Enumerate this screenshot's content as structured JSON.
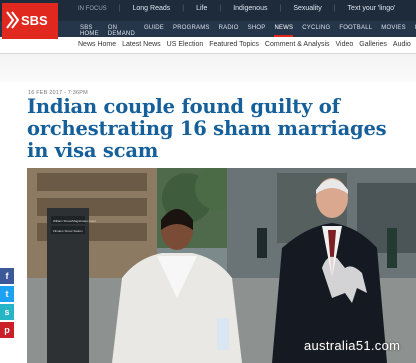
{
  "logo": {
    "text": "SBS"
  },
  "top_nav": {
    "in_focus": "IN FOCUS",
    "items": [
      "Long Reads",
      "Life",
      "Indigenous",
      "Sexuality",
      "Text your 'lingo'"
    ]
  },
  "main_nav": {
    "items": [
      "SBS HOME",
      "ON DEMAND",
      "GUIDE",
      "PROGRAMS",
      "RADIO",
      "SHOP",
      "NEWS",
      "CYCLING",
      "FOOTBALL",
      "MOVIES",
      "FO"
    ],
    "active": "NEWS"
  },
  "sub_nav": {
    "items": [
      "News Home",
      "Latest News",
      "US Election",
      "Featured Topics",
      "Comment & Analysis",
      "Video",
      "Galleries",
      "Audio"
    ]
  },
  "article": {
    "date": "16 FEB 2017 - 7:36PM",
    "headline": "Indian couple found guilty of orchestrating 16 sham marriages in visa scam"
  },
  "photo": {
    "sign_line1": "William Street/Magistrates Court",
    "sign_line2": "Flinders Street Station"
  },
  "social": [
    "f",
    "t",
    "s",
    "p"
  ],
  "colors": {
    "accent": "#e1281f",
    "headline": "#155f9a",
    "nav_bg": "#1d2b3a"
  },
  "watermark": {
    "text": "australia51.com"
  }
}
